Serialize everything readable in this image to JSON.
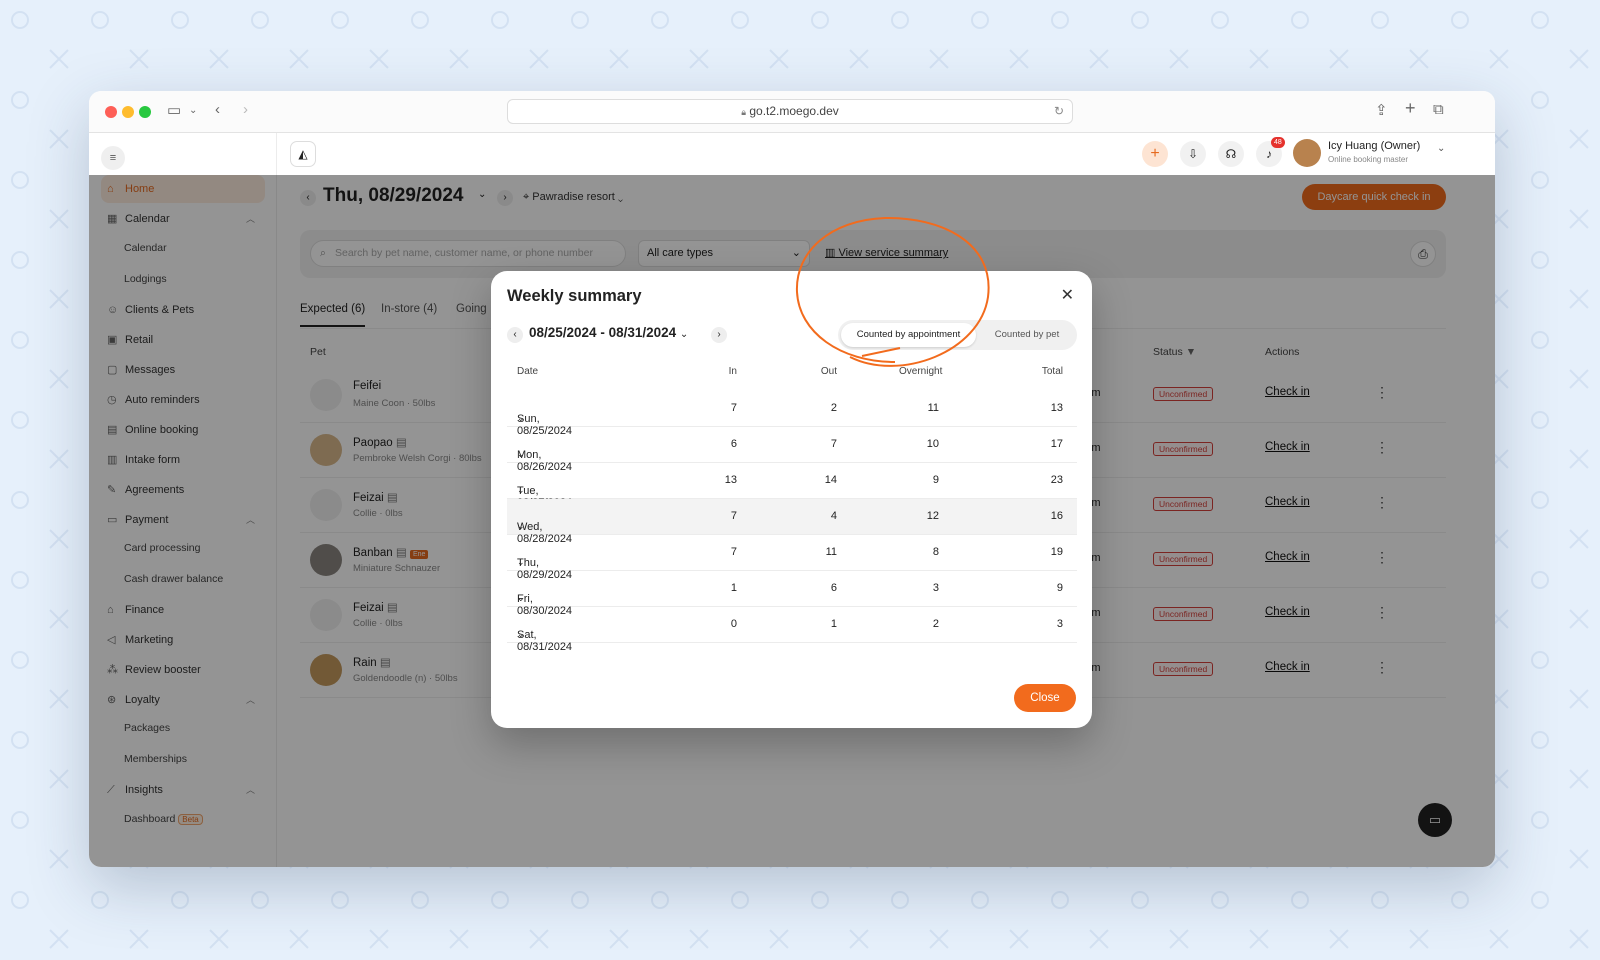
{
  "browser": {
    "url": "go.t2.moego.dev"
  },
  "sidebar": {
    "items": [
      {
        "label": "Home"
      },
      {
        "label": "Calendar"
      },
      {
        "label": "Calendar"
      },
      {
        "label": "Lodgings"
      },
      {
        "label": "Clients & Pets"
      },
      {
        "label": "Retail"
      },
      {
        "label": "Messages"
      },
      {
        "label": "Auto reminders"
      },
      {
        "label": "Online booking"
      },
      {
        "label": "Intake form"
      },
      {
        "label": "Agreements"
      },
      {
        "label": "Payment"
      },
      {
        "label": "Card processing"
      },
      {
        "label": "Cash drawer balance"
      },
      {
        "label": "Finance"
      },
      {
        "label": "Marketing"
      },
      {
        "label": "Review booster"
      },
      {
        "label": "Loyalty"
      },
      {
        "label": "Packages"
      },
      {
        "label": "Memberships"
      },
      {
        "label": "Insights"
      },
      {
        "label": "Dashboard"
      }
    ],
    "beta_badge": "Beta"
  },
  "header": {
    "notification_count": "48",
    "user_name": "Icy Huang (Owner)",
    "user_role": "Online booking master",
    "date": "Thu, 08/29/2024",
    "location": "Pawradise resort",
    "quick_checkin": "Daycare quick check in"
  },
  "filters": {
    "search_placeholder": "Search by pet name, customer name, or phone number",
    "care_type": "All care types",
    "service_summary": "View service summary"
  },
  "tabs": [
    {
      "label": "Expected (6)"
    },
    {
      "label": "In-store (4)"
    },
    {
      "label": "Going"
    }
  ],
  "table": {
    "col_pet": "Pet",
    "col_status": "Status",
    "col_actions": "Actions",
    "rows": [
      {
        "name": "Feifei",
        "breed": "Maine Coon · 50lbs",
        "time": "13 am",
        "status": "Unconfirmed",
        "action": "Check in"
      },
      {
        "name": "Paopao",
        "breed": "Pembroke Welsh Corgi · 80lbs",
        "time": "50 am",
        "status": "Unconfirmed",
        "action": "Check in"
      },
      {
        "name": "Feizai",
        "breed": "Collie · 0lbs",
        "time": "00 pm",
        "status": "Unconfirmed",
        "action": "Check in"
      },
      {
        "name": "Banban",
        "breed": "Miniature Schnauzer",
        "tag": "Ene",
        "time": "50 am",
        "status": "Unconfirmed",
        "action": "Check in"
      },
      {
        "name": "Feizai",
        "breed": "Collie · 0lbs",
        "time": "00 pm",
        "status": "Unconfirmed",
        "action": "Check in"
      },
      {
        "name": "Rain",
        "breed": "Goldendoodle (n) · 50lbs",
        "time": "00 pm",
        "status": "Unconfirmed",
        "action": "Check in"
      }
    ]
  },
  "modal": {
    "title": "Weekly summary",
    "range": "08/25/2024 - 08/31/2024",
    "toggle_appt": "Counted by appointment",
    "toggle_pet": "Counted by pet",
    "headers": {
      "date": "Date",
      "in": "In",
      "out": "Out",
      "overnight": "Overnight",
      "total": "Total"
    },
    "rows": [
      {
        "date": "Sun, 08/25/2024",
        "in": "7",
        "out": "2",
        "overnight": "11",
        "total": "13"
      },
      {
        "date": "Mon, 08/26/2024",
        "in": "6",
        "out": "7",
        "overnight": "10",
        "total": "17"
      },
      {
        "date": "Tue, 08/27/2024",
        "in": "13",
        "out": "14",
        "overnight": "9",
        "total": "23"
      },
      {
        "date": "Wed, 08/28/2024",
        "in": "7",
        "out": "4",
        "overnight": "12",
        "total": "16"
      },
      {
        "date": "Thu, 08/29/2024",
        "in": "7",
        "out": "11",
        "overnight": "8",
        "total": "19"
      },
      {
        "date": "Fri, 08/30/2024",
        "in": "1",
        "out": "6",
        "overnight": "3",
        "total": "9"
      },
      {
        "date": "Sat, 08/31/2024",
        "in": "0",
        "out": "1",
        "overnight": "2",
        "total": "3"
      }
    ],
    "close": "Close"
  },
  "colors": {
    "accent": "#f26b1d",
    "badge_red": "#d5413b"
  }
}
